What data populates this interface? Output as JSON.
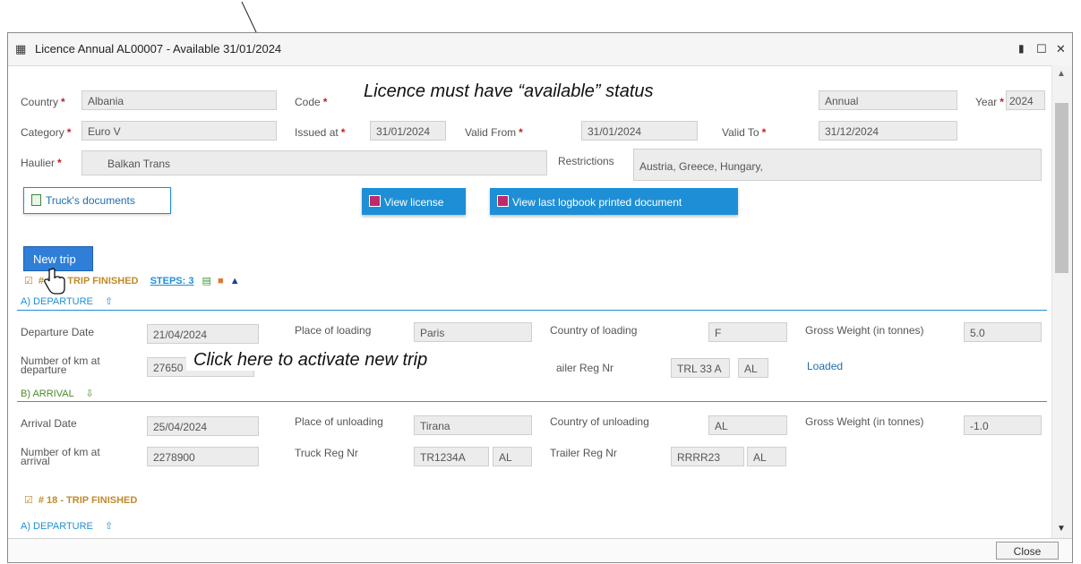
{
  "window": {
    "title": "Licence Annual AL00007 - Available 31/01/2024",
    "close_label": "Close"
  },
  "annotations": {
    "status_note": "Licence must have “available” status",
    "new_trip_note": "Click here to activate new trip"
  },
  "licence": {
    "country_label": "Country",
    "country_value": "Albania",
    "code_label": "Code",
    "type_value": "Annual",
    "year_label": "Year",
    "year_value": "2024",
    "category_label": "Category",
    "category_value": "Euro V",
    "issued_at_label": "Issued at",
    "issued_at_value": "31/01/2024",
    "valid_from_label": "Valid From",
    "valid_from_value": "31/01/2024",
    "valid_to_label": "Valid To",
    "valid_to_value": "31/12/2024",
    "haulier_label": "Haulier",
    "haulier_value": "Balkan Trans",
    "restrictions_label": "Restrictions",
    "restrictions_value": "Austria,  Greece,  Hungary,"
  },
  "buttons": {
    "trucks_documents": "Truck's documents",
    "view_license": "View license",
    "view_logbook": "View last logbook printed document",
    "new_trip": "New trip"
  },
  "trip1": {
    "header_prefix": "# 1",
    "header_status": "TRIP FINISHED",
    "steps_label": "STEPS: 3",
    "departure_section": "A) DEPARTURE",
    "departure_date_label": "Departure Date",
    "departure_date_value": "21/04/2024",
    "place_loading_label": "Place of loading",
    "place_loading_value": "Paris",
    "country_loading_label": "Country of loading",
    "country_loading_value": "F",
    "gross_weight_label": "Gross Weight (in tonnes)",
    "gross_weight_dep_value": "5.0",
    "km_departure_label_1": "Number of km at",
    "km_departure_label_2": "departure",
    "km_departure_value": "27650",
    "trailer_reg_label": "ailer Reg Nr",
    "trailer_reg_dep_value": "TRL 33 A",
    "trailer_reg_dep_country": "AL",
    "loaded_label": "Loaded",
    "arrival_section": "B) ARRIVAL",
    "arrival_date_label": "Arrival Date",
    "arrival_date_value": "25/04/2024",
    "place_unloading_label": "Place of unloading",
    "place_unloading_value": "Tirana",
    "country_unloading_label": "Country of unloading",
    "country_unloading_value": "AL",
    "gross_weight_arr_value": "-1.0",
    "km_arrival_label_1": "Number of km at",
    "km_arrival_label_2": "arrival",
    "km_arrival_value": "2278900",
    "truck_reg_label": "Truck Reg Nr",
    "truck_reg_value": "TR1234A",
    "truck_reg_country": "AL",
    "trailer_reg_arr_label": "Trailer Reg Nr",
    "trailer_reg_arr_value": "RRRR23",
    "trailer_reg_arr_country": "AL"
  },
  "trip18": {
    "header": "# 18 - TRIP FINISHED",
    "departure_section": "A) DEPARTURE"
  },
  "colors": {
    "accent_blue": "#1e8fd6",
    "trip_gold": "#c08a2a",
    "required_red": "#c0202a",
    "arrival_green": "#5aa03a"
  }
}
